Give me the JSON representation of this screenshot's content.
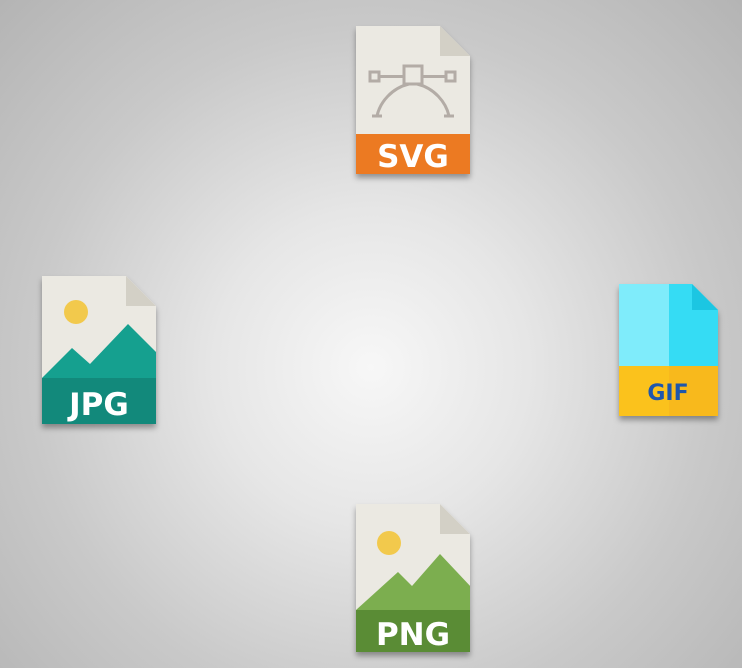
{
  "files": {
    "svg": {
      "label": "SVG",
      "icon": "vector-pen-tool",
      "colors": {
        "band": "#ec7a22",
        "body": "#ebe9e2",
        "fold": "#d3d0c6",
        "glyph": "#b3aca6"
      }
    },
    "jpg": {
      "label": "JPG",
      "icon": "image-mountains",
      "colors": {
        "band": "#12897b",
        "body": "#ebe9e2",
        "fold": "#d3d0c6",
        "mountain": "#15a08f",
        "sun": "#f2c94c"
      }
    },
    "gif": {
      "label": "GIF",
      "icon": "blank-document",
      "colors": {
        "band": "#fbc21e",
        "body": "#7fecfb",
        "fold": "#30d9f2",
        "text": "#1e57ad"
      }
    },
    "png": {
      "label": "PNG",
      "icon": "image-mountains",
      "colors": {
        "band": "#5a8c35",
        "body": "#ebe9e2",
        "fold": "#d3d0c6",
        "mountain": "#7cae4f",
        "sun": "#f2c94c"
      }
    }
  }
}
